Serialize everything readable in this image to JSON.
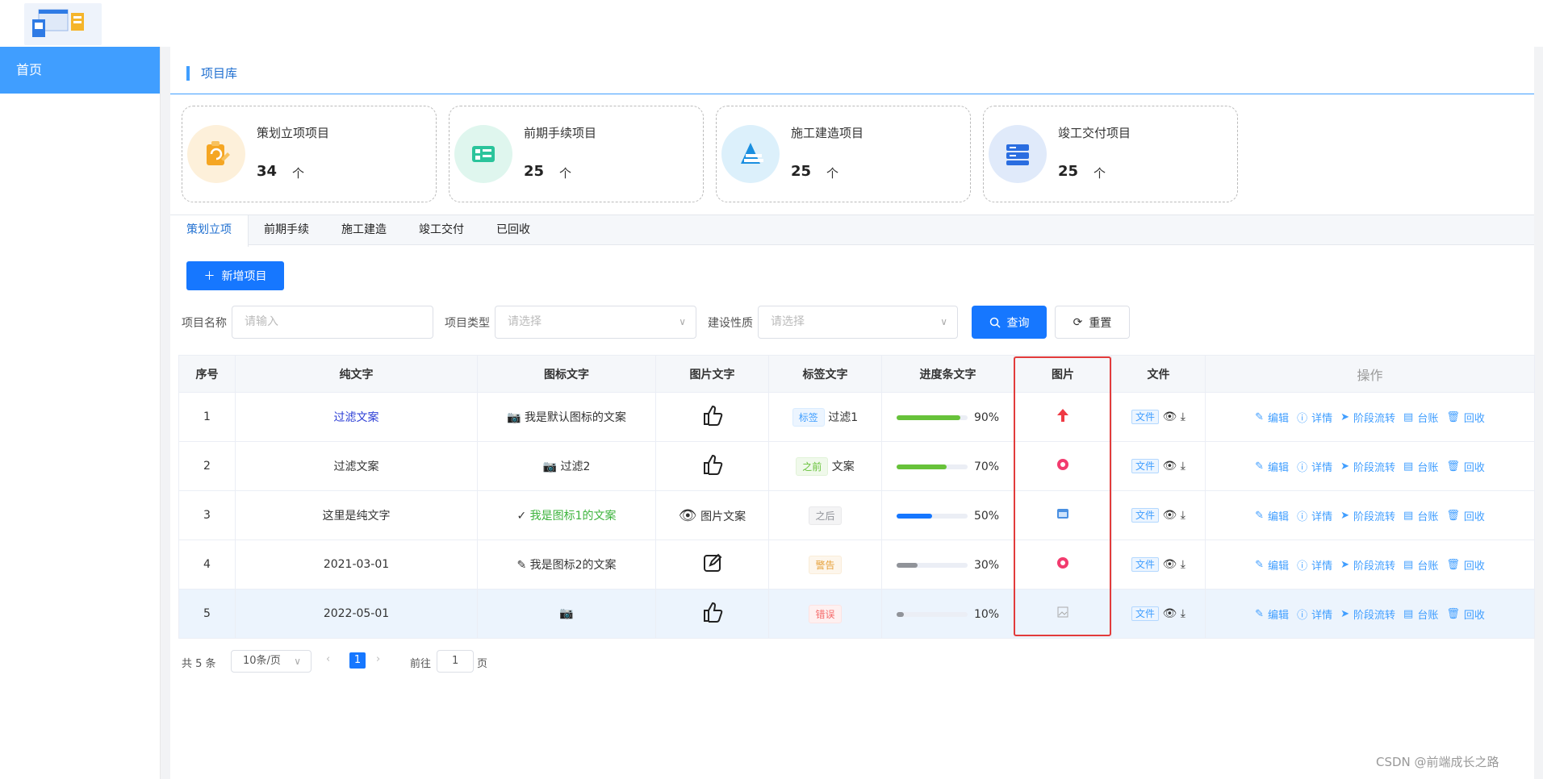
{
  "sidebar": {
    "items": [
      {
        "label": "首页"
      }
    ]
  },
  "breadcrumb": "项目库",
  "stats": [
    {
      "name": "策划立项项目",
      "count": "34",
      "unit": "个",
      "color": "#f5a623",
      "bg": "#fdf0da"
    },
    {
      "name": "前期手续项目",
      "count": "25",
      "unit": "个",
      "color": "#2bc49b",
      "bg": "#dff6ee"
    },
    {
      "name": "施工建造项目",
      "count": "25",
      "unit": "个",
      "color": "#1a8fe0",
      "bg": "#dcf0fb"
    },
    {
      "name": "竣工交付项目",
      "count": "25",
      "unit": "个",
      "color": "#2a6de0",
      "bg": "#e0eafa"
    }
  ],
  "tabs": [
    "策划立项",
    "前期手续",
    "施工建造",
    "竣工交付",
    "已回收"
  ],
  "add_button": "新增项目",
  "filters": {
    "name_label": "项目名称",
    "name_placeholder": "请输入",
    "type_label": "项目类型",
    "type_placeholder": "请选择",
    "nature_label": "建设性质",
    "nature_placeholder": "请选择"
  },
  "query_button": "查询",
  "reset_button": "重置",
  "table": {
    "headers": [
      "序号",
      "纯文字",
      "图标文字",
      "图片文字",
      "标签文字",
      "进度条文字",
      "图片",
      "文件",
      "操作"
    ],
    "rows": [
      {
        "no": "1",
        "text": "过滤文案",
        "icon_text": "我是默认图标的文案",
        "image_text": "",
        "tag": "标签",
        "tag_extra": "过滤1",
        "progress": "90%",
        "progress_value": 90,
        "file": "文件"
      },
      {
        "no": "2",
        "text": "过滤文案",
        "icon_text": "过滤2",
        "image_text": "",
        "tag": "之前",
        "tag_extra": "文案",
        "progress": "70%",
        "progress_value": 70,
        "file": "文件"
      },
      {
        "no": "3",
        "text": "这里是纯文字",
        "icon_text": "我是图标1的文案",
        "image_text": "图片文案",
        "tag": "之后",
        "tag_extra": "",
        "progress": "50%",
        "progress_value": 50,
        "file": "文件"
      },
      {
        "no": "4",
        "text": "2021-03-01",
        "icon_text": "我是图标2的文案",
        "image_text": "",
        "tag": "警告",
        "tag_extra": "",
        "progress": "30%",
        "progress_value": 30,
        "file": "文件"
      },
      {
        "no": "5",
        "text": "2022-05-01",
        "icon_text": "",
        "image_text": "",
        "tag": "错误",
        "tag_extra": "",
        "progress": "10%",
        "progress_value": 10,
        "file": "文件"
      }
    ],
    "actions": [
      "编辑",
      "详情",
      "阶段流转",
      "台账",
      "回收"
    ]
  },
  "pagination": {
    "total": "共 5 条",
    "page_size": "10条/页",
    "current": "1",
    "goto_label": "前往",
    "goto_value": "1",
    "page_suffix": "页"
  },
  "watermark": "CSDN @前端成长之路"
}
